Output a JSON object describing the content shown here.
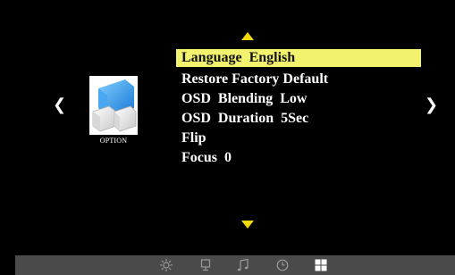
{
  "option_label": "OPTION",
  "nav": {
    "left": "❮",
    "right": "❯"
  },
  "menu": {
    "items": [
      {
        "label": "Language  English",
        "selected": true
      },
      {
        "label": "Restore Factory Default",
        "selected": false
      },
      {
        "label": "OSD  Blending  Low",
        "selected": false
      },
      {
        "label": "OSD  Duration  5Sec",
        "selected": false
      },
      {
        "label": "Flip",
        "selected": false
      },
      {
        "label": "Focus  0",
        "selected": false
      }
    ]
  },
  "bottom_icons": [
    "brightness-icon",
    "display-icon",
    "music-icon",
    "clock-icon",
    "option-grid-icon"
  ],
  "colors": {
    "highlight": "#f2f26e",
    "arrow": "#f2d90c",
    "bar": "#4a4a4a"
  }
}
